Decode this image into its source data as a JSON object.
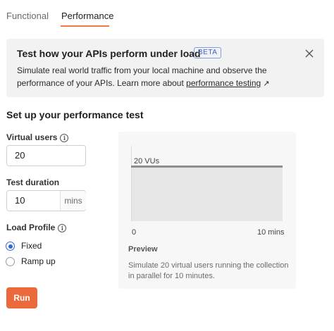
{
  "tabs": {
    "functional": "Functional",
    "performance": "Performance",
    "active": "Performance"
  },
  "banner": {
    "title": "Test how your APIs perform under load",
    "badge": "BETA",
    "description": "Simulate real world traffic from your local machine and observe the performance of your APIs. Learn more about",
    "link_text": "performance testing",
    "link_arrow": "↗",
    "close_icon": "close-icon"
  },
  "setup": {
    "title": "Set up your performance test",
    "virtual_users": {
      "label": "Virtual users",
      "value": "20",
      "info_icon": "info-icon"
    },
    "test_duration": {
      "label": "Test duration",
      "value": "10",
      "unit": "mins"
    },
    "load_profile": {
      "label": "Load Profile",
      "info_icon": "info-icon",
      "options": [
        {
          "label": "Fixed",
          "selected": true
        },
        {
          "label": "Ramp up",
          "selected": false
        }
      ]
    },
    "run_label": "Run"
  },
  "preview": {
    "series_label": "20 VUs",
    "x_start": "0",
    "x_end": "10 mins",
    "title": "Preview",
    "description": "Simulate 20 virtual users running the collection in parallel for 10 minutes."
  },
  "colors": {
    "accent": "#ea6a3c",
    "tab_underline": "#ef7a45",
    "radio": "#2f67d8",
    "badge": "#3a5fd6"
  }
}
